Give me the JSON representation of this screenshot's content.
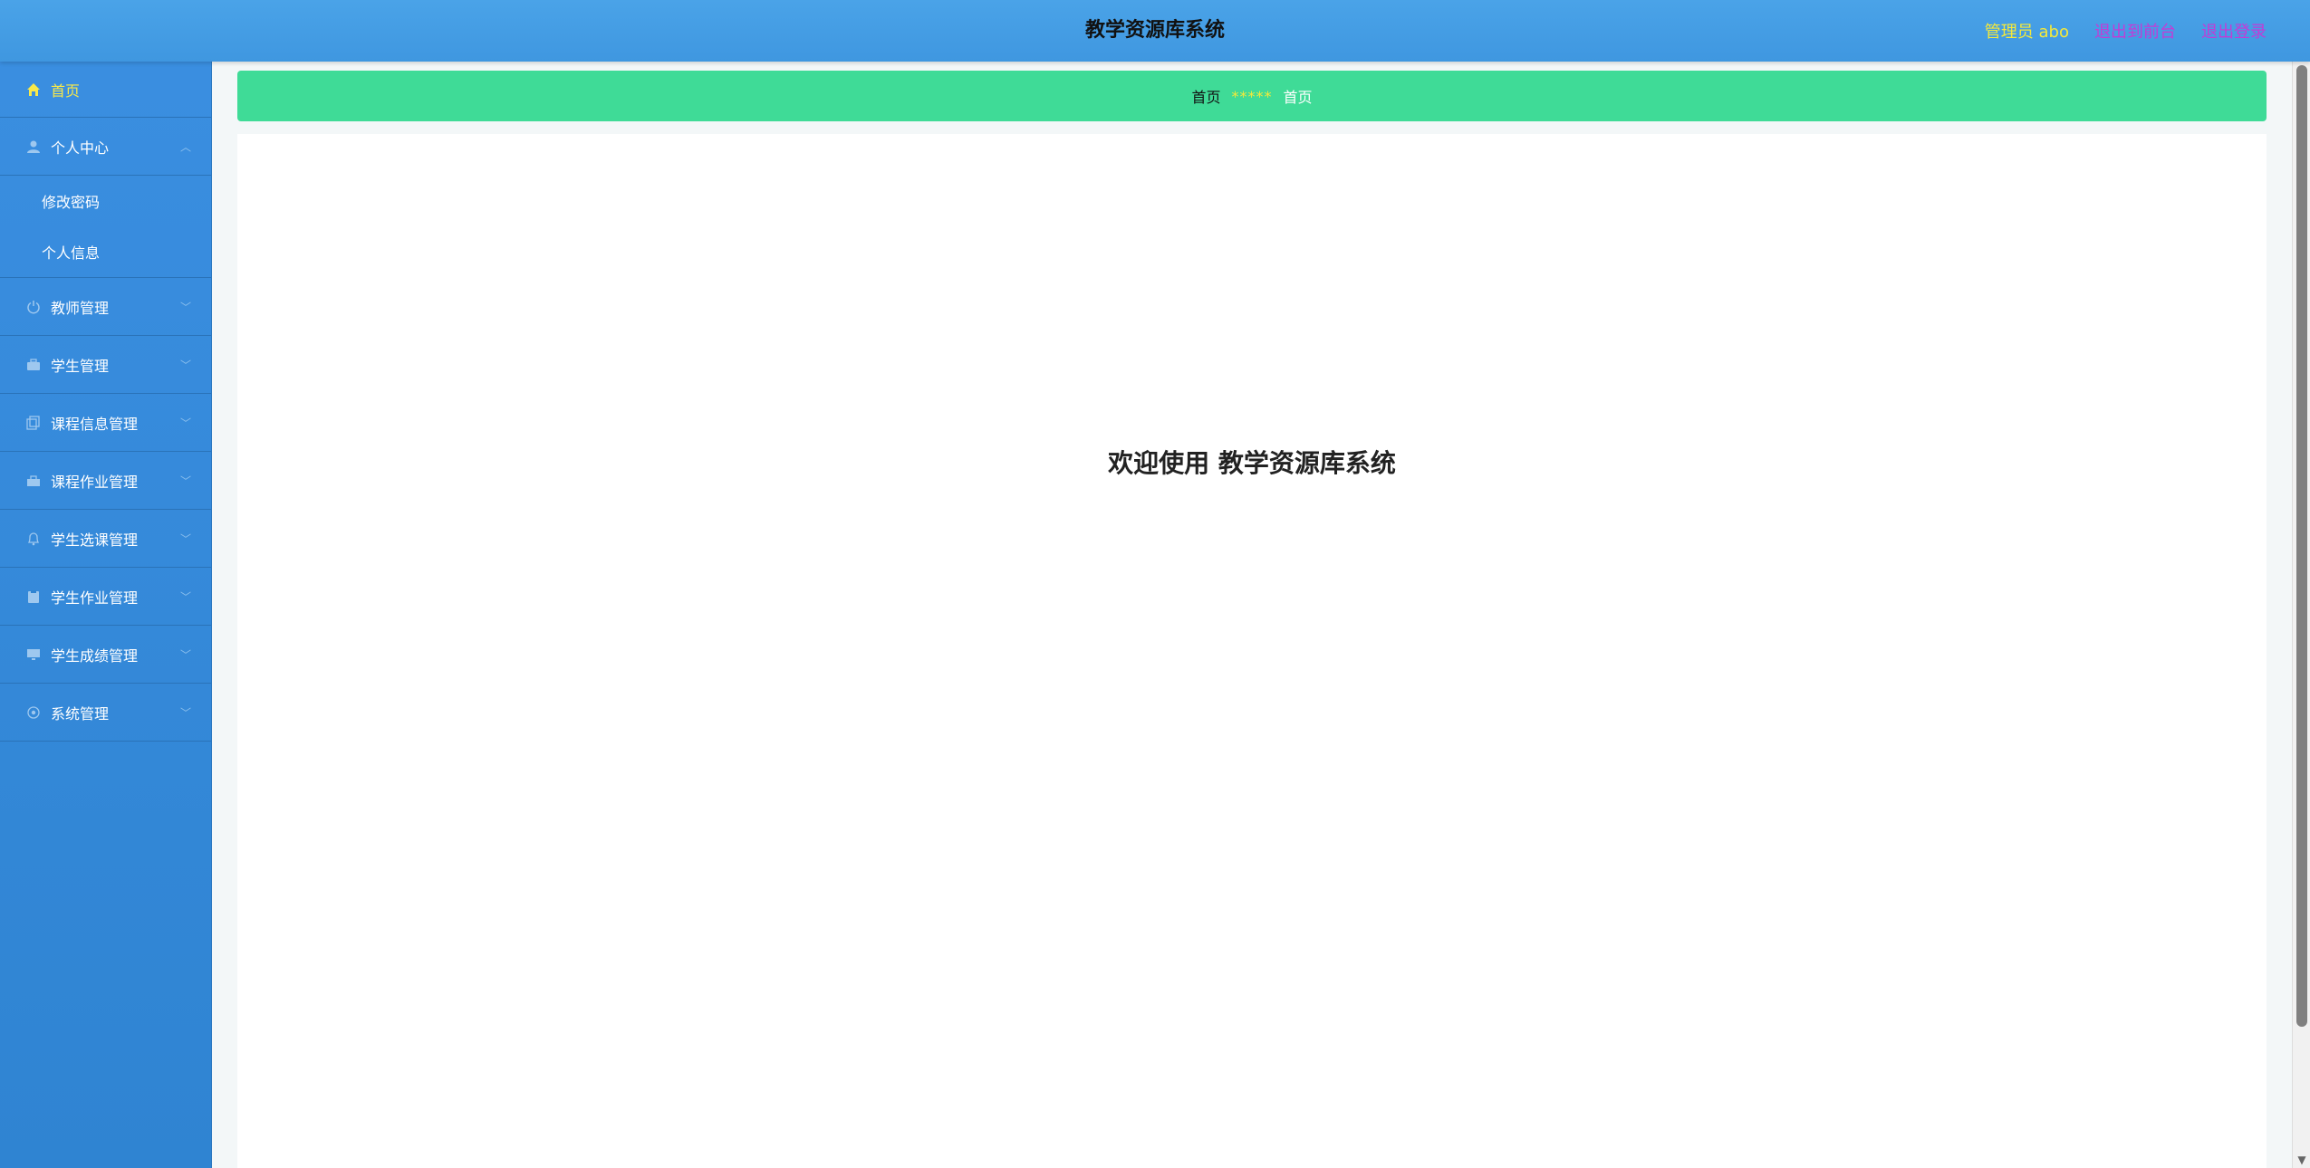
{
  "header": {
    "title": "教学资源库系统",
    "user_label": "管理员 abo",
    "back_to_front": "退出到前台",
    "logout": "退出登录"
  },
  "sidebar": {
    "home": {
      "label": "首页",
      "icon": "home-icon"
    },
    "personal_center": {
      "label": "个人中心",
      "icon": "user-icon",
      "children": [
        "修改密码",
        "个人信息"
      ]
    },
    "items": [
      {
        "label": "教师管理",
        "icon": "power-icon"
      },
      {
        "label": "学生管理",
        "icon": "briefcase-icon"
      },
      {
        "label": "课程信息管理",
        "icon": "copy-icon"
      },
      {
        "label": "课程作业管理",
        "icon": "toolbox-icon"
      },
      {
        "label": "学生选课管理",
        "icon": "bell-icon"
      },
      {
        "label": "学生作业管理",
        "icon": "clipboard-icon"
      },
      {
        "label": "学生成绩管理",
        "icon": "monitor-icon"
      },
      {
        "label": "系统管理",
        "icon": "settings-icon"
      }
    ]
  },
  "breadcrumb": {
    "home": "首页",
    "separator": "*****",
    "current": "首页"
  },
  "main": {
    "welcome": "欢迎使用 教学资源库系统"
  },
  "colors": {
    "header_bg": "#4aa3e8",
    "sidebar_bg": "#3a8ee0",
    "breadcrumb_bg": "#3fdb97",
    "user_label": "#f5e93a",
    "nav_link": "#c33bd6",
    "active_menu": "#f8e94a"
  }
}
